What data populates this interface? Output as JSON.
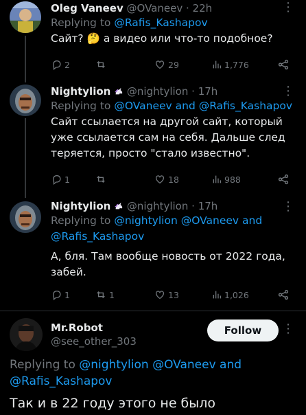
{
  "tweets": [
    {
      "name": "Oleg Vaneev",
      "handle": "@OVaneev",
      "time": "22h",
      "replying_prefix": "Replying to ",
      "replying_to": "@Rafis_Kashapov",
      "replying_extra": "",
      "text_parts": [
        "Сайт? ",
        "а видео или что-то подобное?"
      ],
      "emoji": "🤔",
      "replies": "2",
      "retweets": "",
      "likes": "29",
      "views": "1,776"
    },
    {
      "name": "Nightylion",
      "handle": "@nightylion",
      "time": "17h",
      "replying_prefix": "Replying to ",
      "replying_to": "@OVaneev and @Rafis_Kashapov",
      "text_lines": [
        "Сайт ссылается на другой сайт, который",
        "уже ссылается сам на себя. Дальше след",
        "теряется, просто \"стало известно\"."
      ],
      "replies": "1",
      "retweets": "",
      "likes": "18",
      "views": "988"
    },
    {
      "name": "Nightylion",
      "handle": "@nightylion",
      "time": "17h",
      "replying_prefix": "Replying to ",
      "replying_line1": "@nightylion @OVaneev and",
      "replying_line2": "@Rafis_Kashapov",
      "text_lines": [
        "А, бля. Там вообще новость от 2022 года,",
        "забей."
      ],
      "replies": "1",
      "retweets": "1",
      "likes": "13",
      "views": "1,026"
    }
  ],
  "focused": {
    "name": "Mr.Robot",
    "handle": "@see_other_303",
    "follow_label": "Follow",
    "replying_prefix": "Replying to ",
    "replying_line1": "@nightylion @OVaneev and",
    "replying_line2": "@Rafis_Kashapov",
    "text": "Так и в 22 году этого не было"
  },
  "separator_dot": " · ",
  "colors": {
    "accent": "#1d9bf0",
    "muted": "#71767b",
    "text": "#e7e9ea",
    "background": "#000000"
  }
}
